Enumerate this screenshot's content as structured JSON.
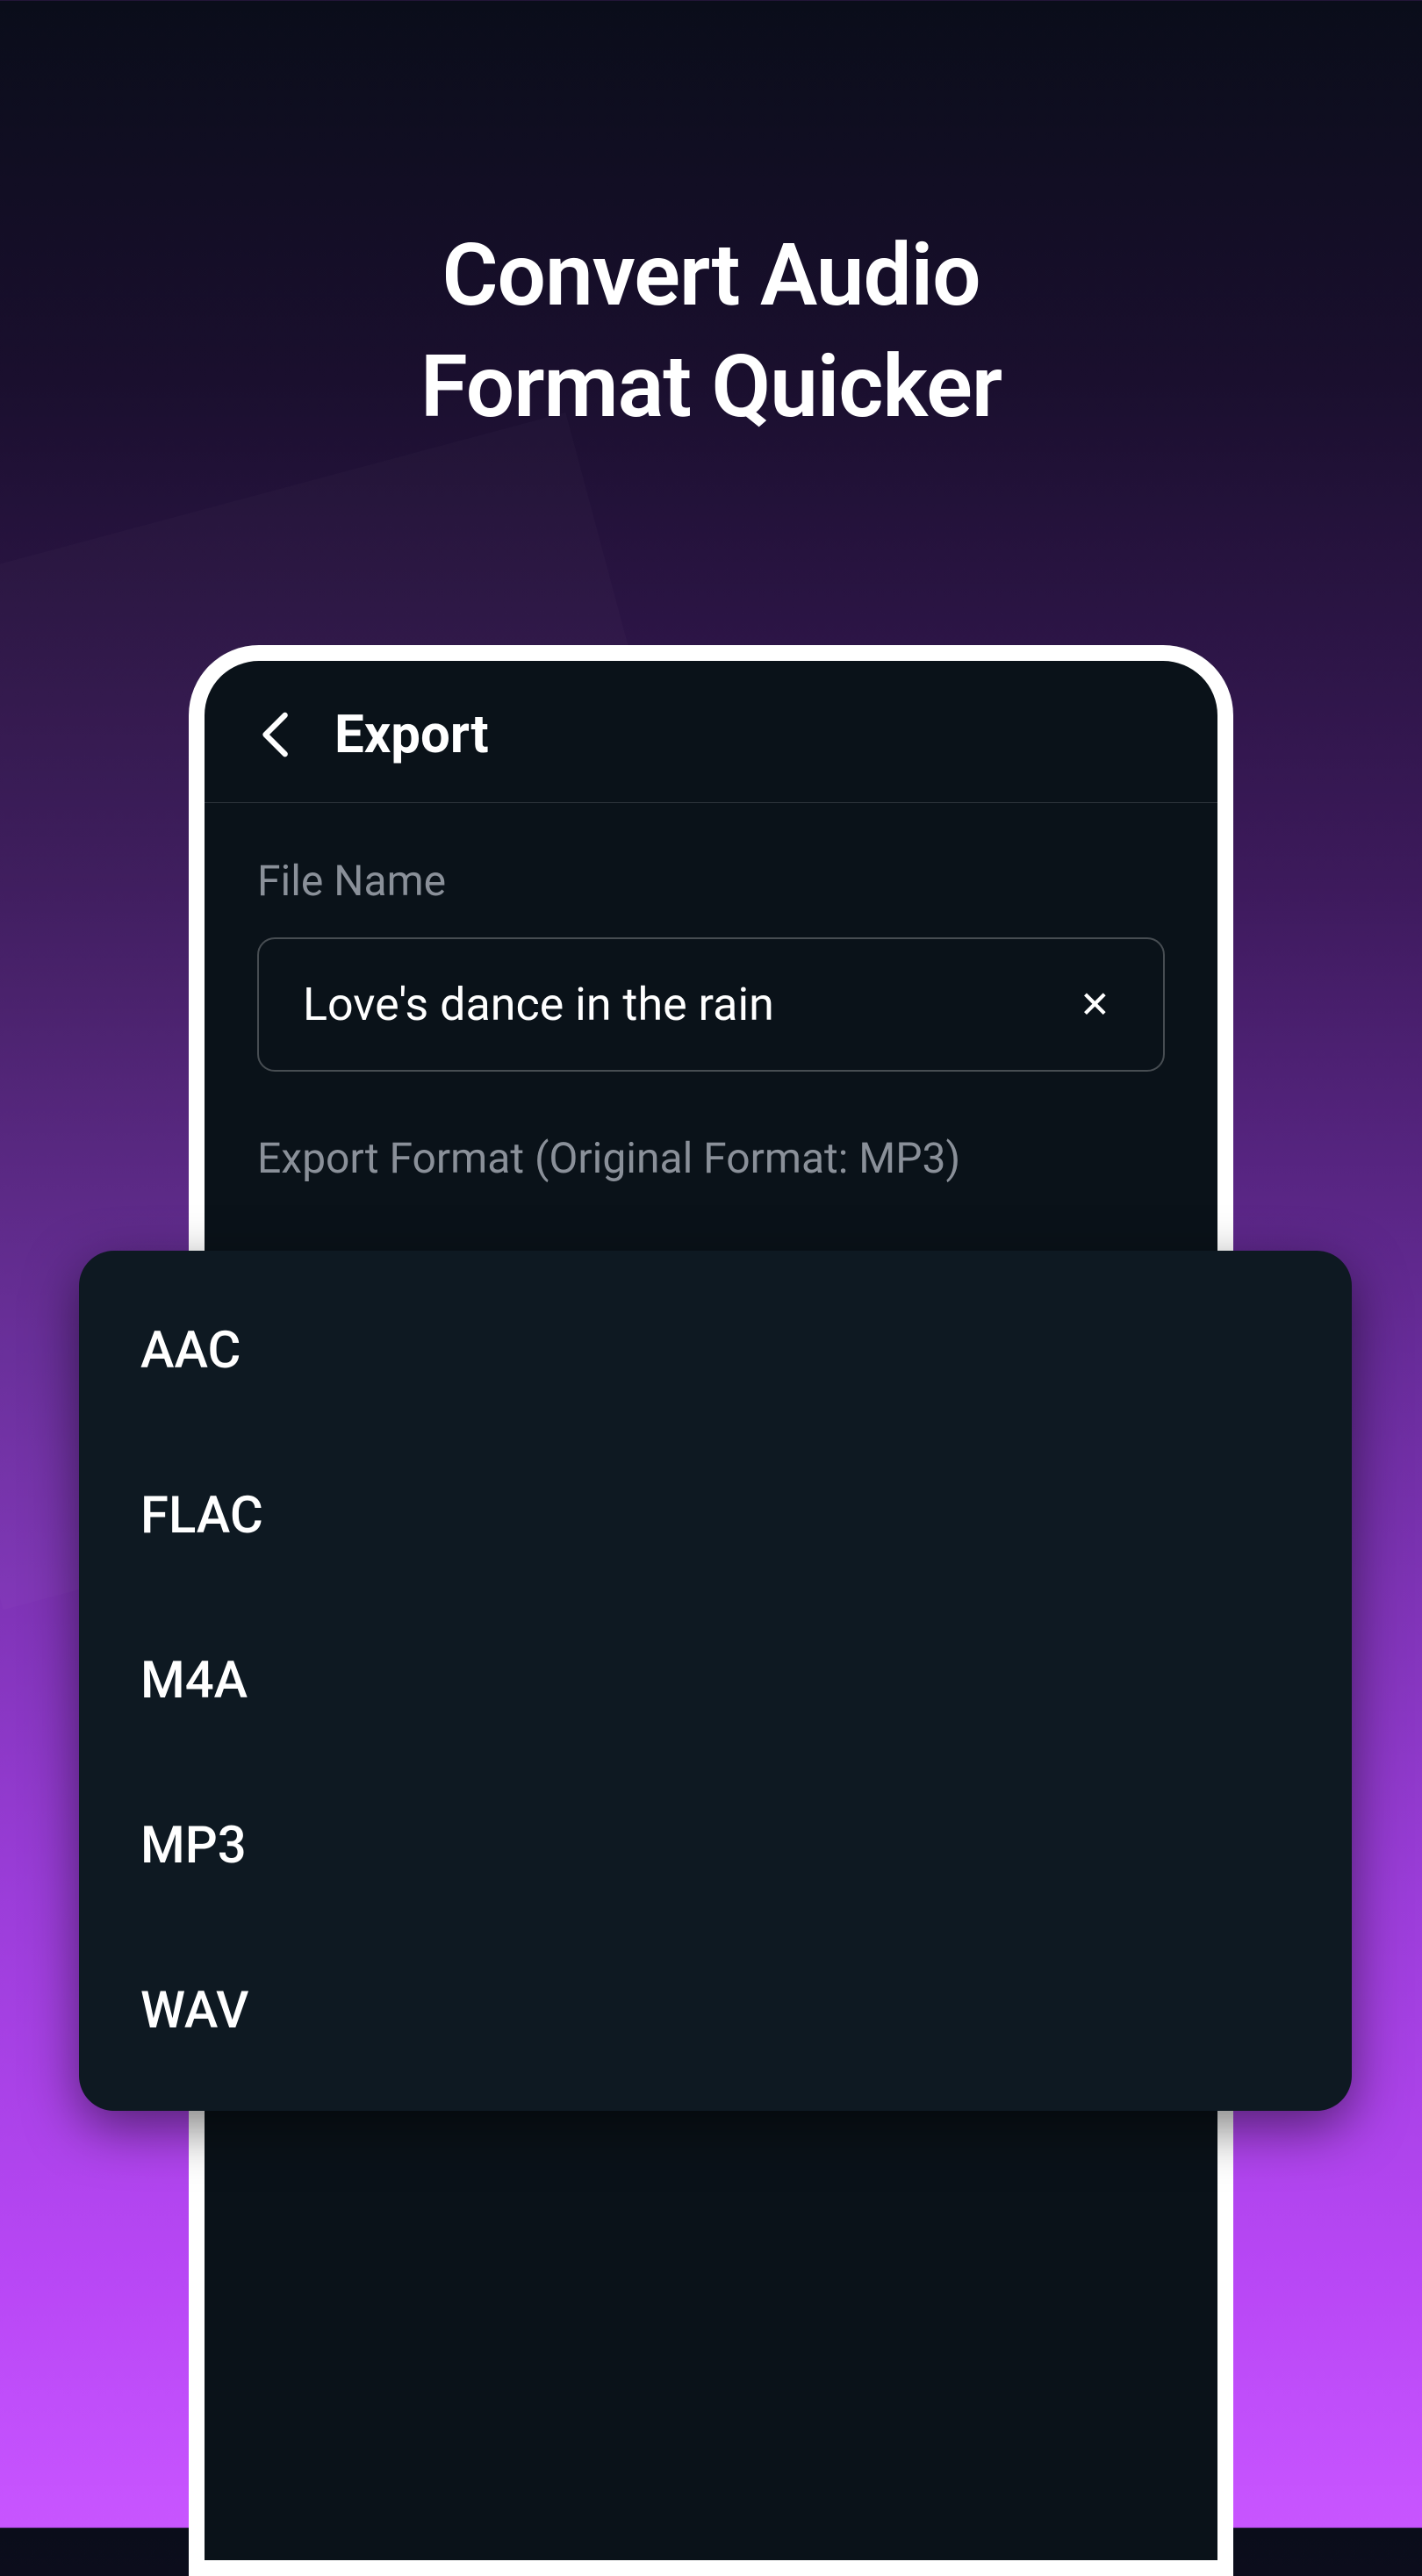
{
  "marketing": {
    "title_line1": "Convert Audio",
    "title_line2": "Format Quicker"
  },
  "header": {
    "title": "Export"
  },
  "fileName": {
    "label": "File Name",
    "value": "Love's dance in the rain"
  },
  "exportFormat": {
    "label": "Export Format (Original Format: MP3)"
  },
  "formatOptions": [
    "AAC",
    "FLAC",
    "M4A",
    "MP3",
    "WAV"
  ]
}
